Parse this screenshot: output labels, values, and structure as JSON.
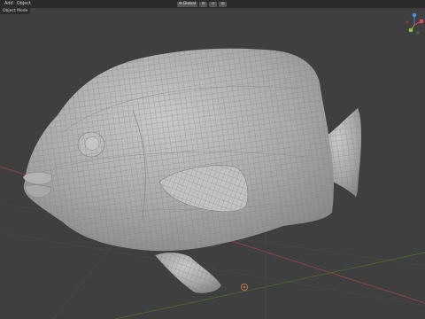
{
  "menubar": {
    "items": [
      {
        "label": "Add"
      },
      {
        "label": "Object"
      }
    ],
    "orientation_label": "Global",
    "pivot_icon": "pivot-icon",
    "snap_icon": "snap-icon",
    "proportional_icon": "proportional-edit-icon"
  },
  "mode_select": {
    "label": "Object Mode"
  },
  "gizmo": {
    "axes": [
      {
        "name": "X",
        "color": "#e84a5f"
      },
      {
        "name": "Y",
        "color": "#8cc63f"
      },
      {
        "name": "Z",
        "color": "#4a90e2"
      }
    ]
  },
  "viewport": {
    "background": "#3f3f3f",
    "grid_x_axis_color": "#9a4a4a",
    "grid_y_axis_color": "#4f6e2d",
    "object": "fish wireframe mesh"
  }
}
